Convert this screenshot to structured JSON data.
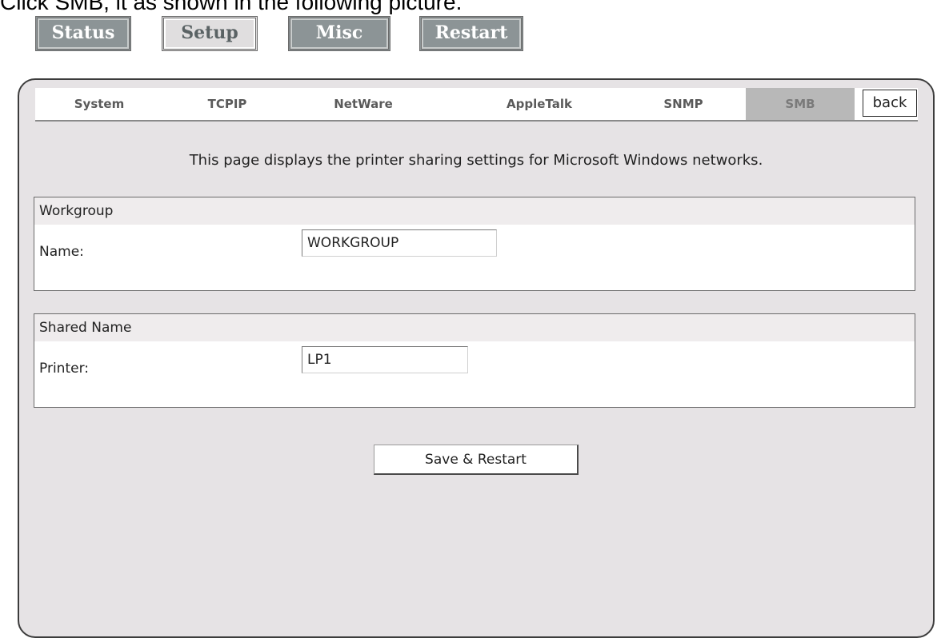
{
  "caption": "Click SMB, it as shown in the following picture.",
  "top_nav": [
    {
      "label": "Status",
      "active": false
    },
    {
      "label": "Setup",
      "active": true
    },
    {
      "label": "Misc",
      "active": false
    },
    {
      "label": "Restart",
      "active": false
    }
  ],
  "tabs": [
    {
      "label": "System",
      "active": false
    },
    {
      "label": "TCPIP",
      "active": false
    },
    {
      "label": "NetWare",
      "active": false
    },
    {
      "label": "AppleTalk",
      "active": false
    },
    {
      "label": "SNMP",
      "active": false
    },
    {
      "label": "SMB",
      "active": true
    }
  ],
  "back_label": "back",
  "description": "This page displays the printer sharing settings for Microsoft Windows networks.",
  "workgroup": {
    "header": "Workgroup",
    "name_label": "Name:",
    "name_value": "WORKGROUP"
  },
  "shared_name": {
    "header": "Shared Name",
    "printer_label": "Printer:",
    "printer_value": "LP1"
  },
  "save_label": "Save & Restart",
  "colors": {
    "panel_bg": "#e6e3e5",
    "nav_button_bg": "#8c9496",
    "active_tab_bg": "#b8b8b8"
  }
}
